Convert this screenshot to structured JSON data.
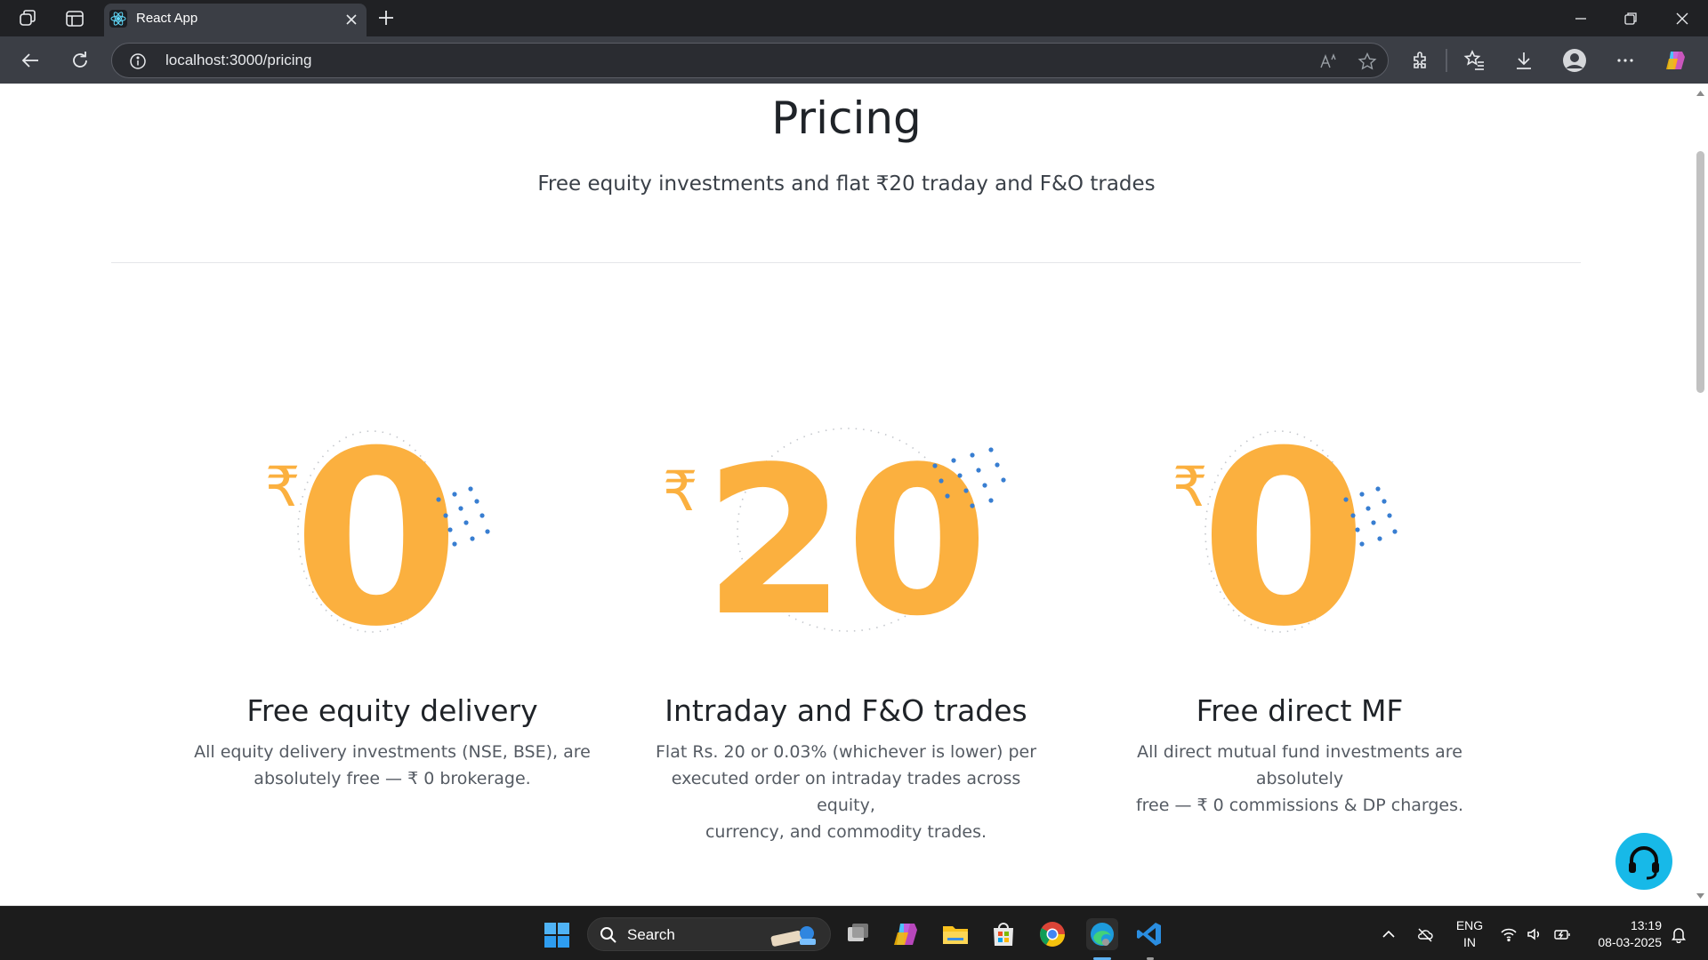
{
  "browser": {
    "tab_title": "React App",
    "url": "localhost:3000/pricing"
  },
  "page": {
    "title": "Pricing",
    "subtitle": "Free equity investments and flat ₹20 traday and F&O trades",
    "cards": [
      {
        "symbol": "₹",
        "amount": "0",
        "title": "Free equity delivery",
        "desc_lines": [
          "All equity delivery investments (NSE, BSE), are",
          "absolutely free — ₹ 0 brokerage."
        ]
      },
      {
        "symbol": "₹",
        "amount": "20",
        "title": "Intraday and F&O trades",
        "desc_lines": [
          "Flat Rs. 20 or 0.03% (whichever is lower) per",
          "executed order on intraday trades across equity,",
          "currency, and commodity trades."
        ]
      },
      {
        "symbol": "₹",
        "amount": "0",
        "title": "Free direct MF",
        "desc_lines": [
          "All direct mutual fund investments are absolutely",
          "free — ₹ 0 commissions & DP charges."
        ]
      }
    ]
  },
  "taskbar": {
    "search_label": "Search",
    "lang_line1": "ENG",
    "lang_line2": "IN",
    "time": "13:19",
    "date": "08-03-2025"
  },
  "colors": {
    "accent_orange": "#fbb03f",
    "dot_blue": "#387ed1",
    "support_cyan": "#17b9e8"
  }
}
